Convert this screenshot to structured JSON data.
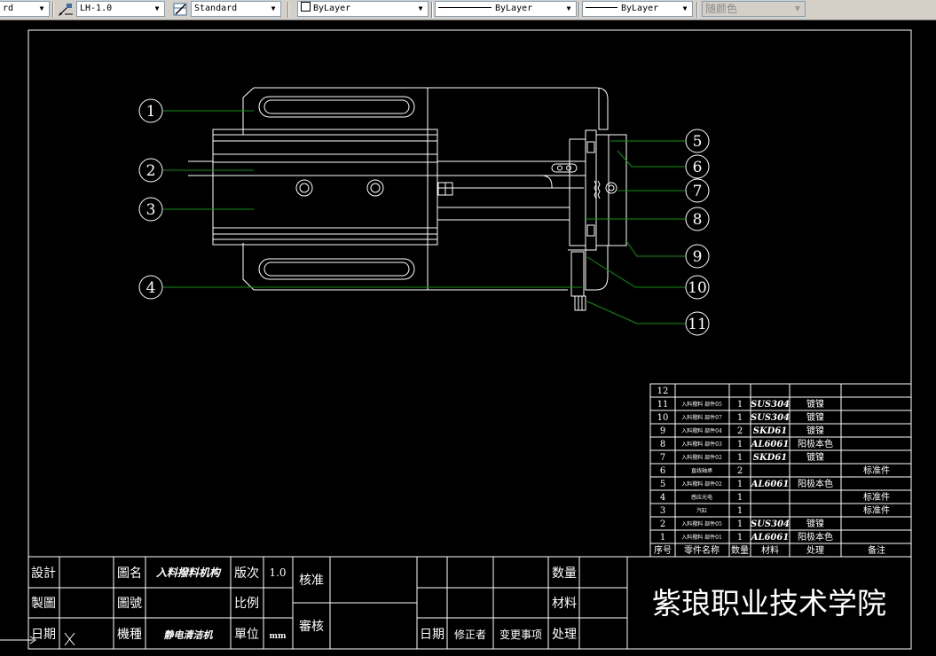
{
  "toolbar": {
    "layer_tail": "rd",
    "multileader_style": "LH-1.0",
    "text_style": "Standard",
    "color": "ByLayer",
    "linetype": "ByLayer",
    "lineweight": "ByLayer",
    "plot_style": "随颜色"
  },
  "balloons": [
    "1",
    "2",
    "3",
    "4",
    "5",
    "6",
    "7",
    "8",
    "9",
    "10",
    "11"
  ],
  "bom": {
    "header": {
      "no": "序号",
      "name": "零件名称",
      "qty": "数量",
      "material": "材料",
      "treatment": "处理",
      "remark": "备注"
    },
    "rows": [
      {
        "no": "12",
        "name": "",
        "qty": "",
        "material": "",
        "treatment": "",
        "remark": ""
      },
      {
        "no": "11",
        "name": "入料撥料 部件05",
        "qty": "1",
        "material": "SUS304",
        "treatment": "镀镍",
        "remark": ""
      },
      {
        "no": "10",
        "name": "入料撥料 部件07",
        "qty": "1",
        "material": "SUS304",
        "treatment": "镀镍",
        "remark": ""
      },
      {
        "no": "9",
        "name": "入料撥料 部件04",
        "qty": "2",
        "material": "SKD61",
        "treatment": "镀镍",
        "remark": ""
      },
      {
        "no": "8",
        "name": "入料撥料 部件03",
        "qty": "1",
        "material": "AL6061",
        "treatment": "阳极本色",
        "remark": ""
      },
      {
        "no": "7",
        "name": "入料撥料 部件02",
        "qty": "1",
        "material": "SKD61",
        "treatment": "镀镍",
        "remark": ""
      },
      {
        "no": "6",
        "name": "直线轴承",
        "qty": "2",
        "material": "",
        "treatment": "",
        "remark": "标准件"
      },
      {
        "no": "5",
        "name": "入料撥料 部件02",
        "qty": "1",
        "material": "AL6061",
        "treatment": "阳极本色",
        "remark": ""
      },
      {
        "no": "4",
        "name": "感应光电",
        "qty": "1",
        "material": "",
        "treatment": "",
        "remark": "标准件"
      },
      {
        "no": "3",
        "name": "汽缸",
        "qty": "1",
        "material": "",
        "treatment": "",
        "remark": "标准件"
      },
      {
        "no": "2",
        "name": "入料撥料 部件05",
        "qty": "1",
        "material": "SUS304",
        "treatment": "镀镍",
        "remark": ""
      },
      {
        "no": "1",
        "name": "入料撥料 部件01",
        "qty": "1",
        "material": "AL6061",
        "treatment": "阳极本色",
        "remark": ""
      }
    ]
  },
  "title_block": {
    "design_label": "設計",
    "draw_label": "製圖",
    "date_label": "日期",
    "drawing_name_label": "圖名",
    "drawing_name": "入料撥料机构",
    "drawing_no_label": "圖號",
    "category_label": "機種",
    "category": "静电清洁机",
    "version_label": "版次",
    "version": "1.0",
    "scale_label": "比例",
    "unit_label": "單位",
    "unit": "mm",
    "approve_label": "核准",
    "review_label": "審核",
    "date2_label": "日期",
    "editor_label": "修正者",
    "change_label": "变更事项",
    "qty_label": "数量",
    "material_label": "材料",
    "treatment_label": "处理",
    "school": "紫琅职业技术学院"
  },
  "ucs_icon": "ucs-axis-icon",
  "colors": {
    "background": "#000000",
    "lines": "#ffffff",
    "leaders": "#00a000",
    "toolbar": "#d4d0c8"
  }
}
